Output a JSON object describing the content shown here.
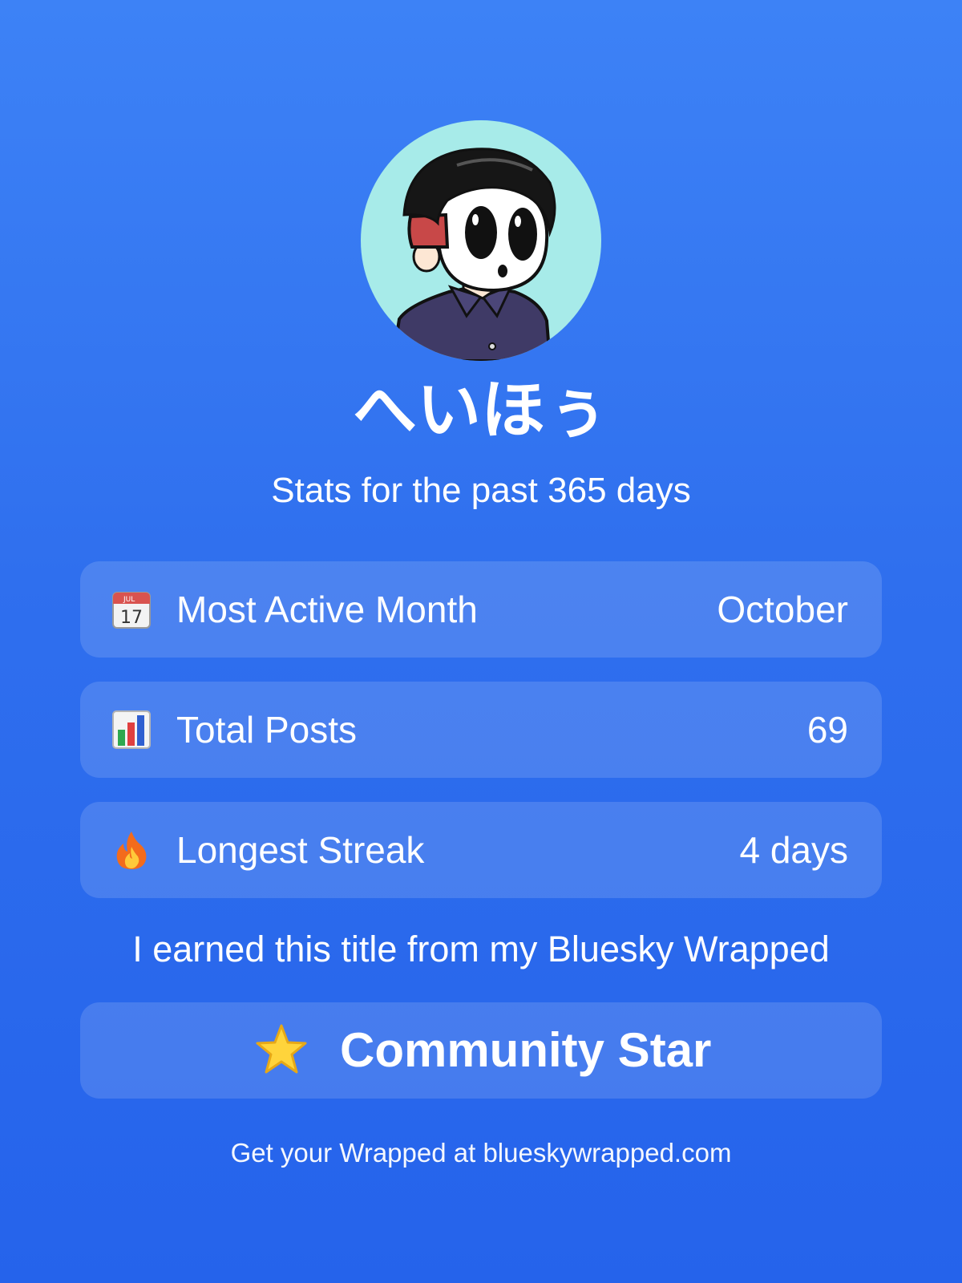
{
  "profile": {
    "display_name": "へいほぅ",
    "subtitle": "Stats for the past 365 days"
  },
  "stats": [
    {
      "icon": "calendar-icon",
      "label": "Most Active Month",
      "value": "October"
    },
    {
      "icon": "bar-chart-icon",
      "label": "Total Posts",
      "value": "69"
    },
    {
      "icon": "fire-icon",
      "label": "Longest Streak",
      "value": "4 days"
    }
  ],
  "calendar_icon": {
    "month": "JUL",
    "day": "17"
  },
  "earned_text": "I earned this title from my Bluesky Wrapped",
  "title_badge": {
    "icon": "star-icon",
    "label": "Community Star"
  },
  "footer": "Get your Wrapped at blueskywrapped.com",
  "colors": {
    "background_top": "#3d82f6",
    "background_bottom": "#2563eb",
    "avatar_bg": "#a7ebe9",
    "text": "#ffffff"
  }
}
